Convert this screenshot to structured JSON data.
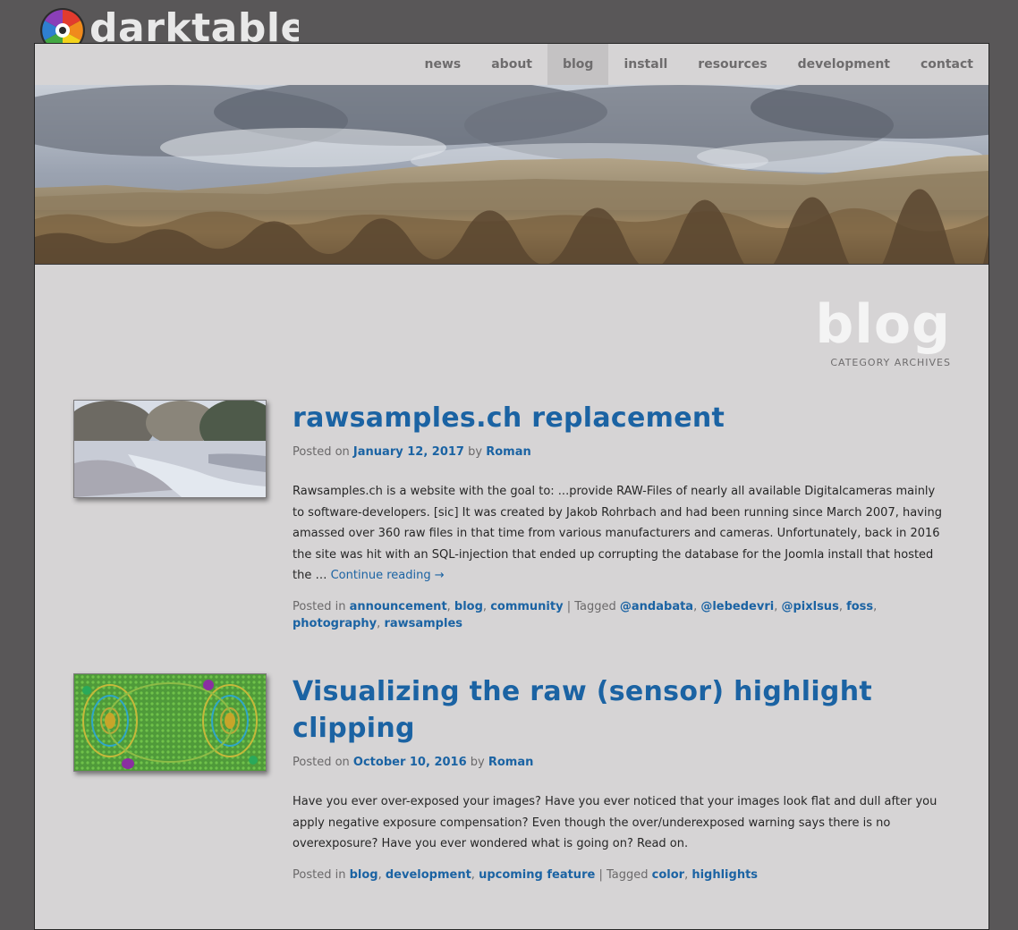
{
  "site": {
    "name": "darktable"
  },
  "nav": {
    "items": [
      "news",
      "about",
      "blog",
      "install",
      "resources",
      "development",
      "contact"
    ],
    "active": "blog"
  },
  "header": {
    "title": "blog",
    "subtitle": "CATEGORY ARCHIVES"
  },
  "posts": [
    {
      "title": "rawsamples.ch replacement",
      "posted_on_label": "Posted on",
      "date": "January 12, 2017",
      "by_label": "by",
      "author": "Roman",
      "excerpt": "Rawsamples.ch is a website with the goal to: ...provide RAW-Files of nearly all available Digitalcameras mainly to software-developers. [sic] It was created by Jakob Rohrbach and had been running since March 2007, having amassed over 360 raw files in that time from various manufacturers and cameras. Unfortunately, back in 2016 the site was hit with an SQL-injection that ended up corrupting the database for the Joomla install that hosted the …",
      "continue": "Continue reading →",
      "posted_in_label": "Posted in",
      "categories": [
        "announcement",
        "blog",
        "community"
      ],
      "tagged_label": "Tagged",
      "tags": [
        "@andabata",
        "@lebedevri",
        "@pixlsus",
        "foss",
        "photography",
        "rawsamples"
      ]
    },
    {
      "title": "Visualizing the raw (sensor) highlight clipping",
      "posted_on_label": "Posted on",
      "date": "October 10, 2016",
      "by_label": "by",
      "author": "Roman",
      "excerpt": "Have you ever over-exposed your images? Have you ever noticed that your images look flat and dull after you apply negative exposure compensation? Even though the over/underexposed warning says there is no overexposure? Have you ever wondered what is going on? Read on.",
      "posted_in_label": "Posted in",
      "categories": [
        "blog",
        "development",
        "upcoming feature"
      ],
      "tagged_label": "Tagged",
      "tags": [
        "color",
        "highlights"
      ]
    }
  ],
  "colors": {
    "background": "#595758",
    "panel": "#d6d4d5",
    "link": "#1b63a3",
    "nav_active": "#c4c2c3"
  }
}
